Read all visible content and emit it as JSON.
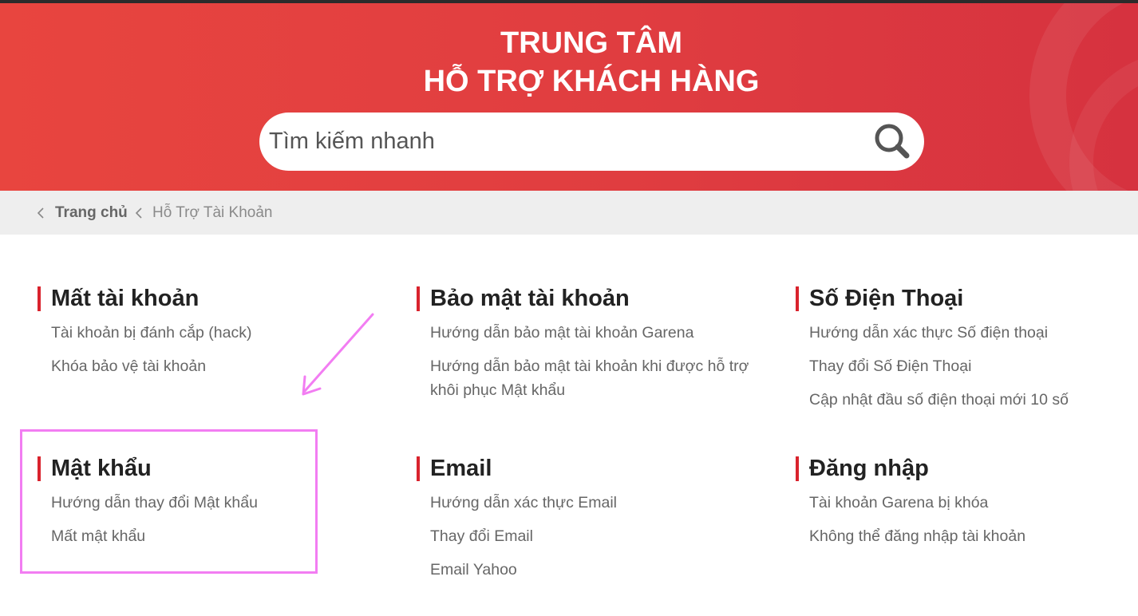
{
  "header": {
    "title_line1": "TRUNG TÂM",
    "title_line2": "HỖ TRỢ KHÁCH HÀNG",
    "search_placeholder": "Tìm kiếm nhanh",
    "search_icon": "search-icon"
  },
  "breadcrumb": {
    "home": "Trang chủ",
    "current": "Hỗ Trợ Tài Khoản"
  },
  "sections": [
    {
      "title": "Mất tài khoản",
      "links": [
        "Tài khoản bị đánh cắp (hack)",
        "Khóa bảo vệ tài khoản"
      ]
    },
    {
      "title": "Bảo mật tài khoản",
      "links": [
        "Hướng dẫn bảo mật tài khoản Garena",
        "Hướng dẫn bảo mật tài khoản khi được hỗ trợ khôi phục Mật khẩu"
      ]
    },
    {
      "title": "Số Điện Thoại",
      "links": [
        "Hướng dẫn xác thực Số điện thoại",
        "Thay đổi Số Điện Thoại",
        "Cập nhật đầu số điện thoại mới 10 số"
      ]
    },
    {
      "title": "Mật khẩu",
      "links": [
        "Hướng dẫn thay đổi Mật khẩu",
        "Mất mật khẩu"
      ]
    },
    {
      "title": "Email",
      "links": [
        "Hướng dẫn xác thực Email",
        "Thay đổi Email",
        "Email Yahoo"
      ]
    },
    {
      "title": "Đăng nhập",
      "links": [
        "Tài khoản Garena bị khóa",
        "Không thể đăng nhập tài khoản"
      ]
    }
  ],
  "colors": {
    "header_red": "#e03d40",
    "section_bar": "#d9232d",
    "annotation": "#f27df2"
  }
}
